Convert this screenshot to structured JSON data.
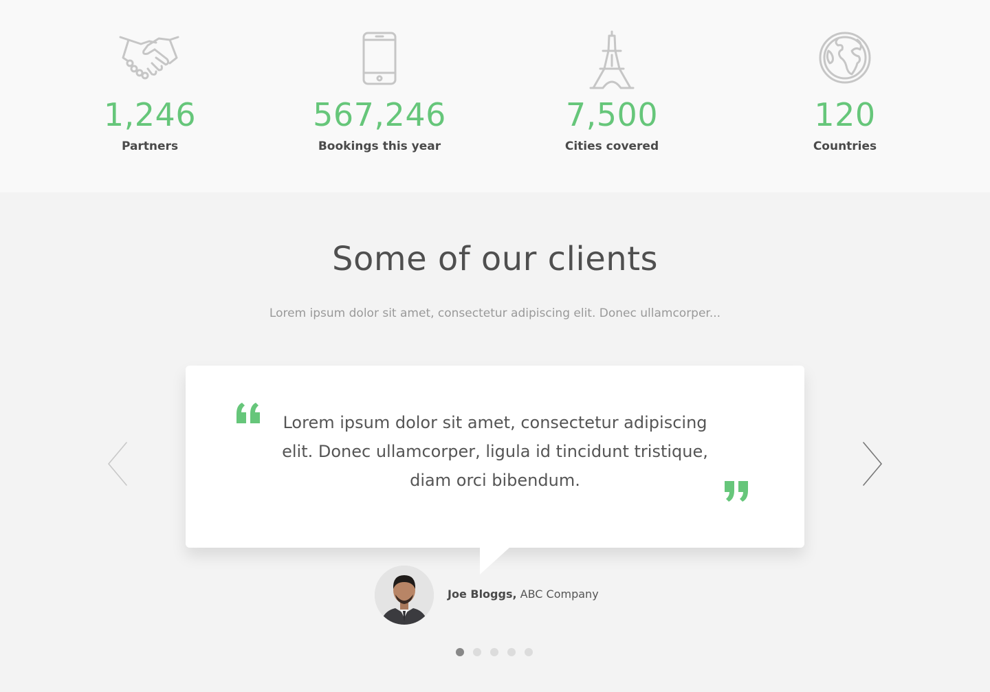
{
  "colors": {
    "accent": "#66c67a",
    "icon": "#c6c6c6",
    "card": "#ffffff"
  },
  "stats": [
    {
      "icon": "handshake-icon",
      "value": "1,246",
      "label": "Partners"
    },
    {
      "icon": "smartphone-icon",
      "value": "567,246",
      "label": "Bookings this year"
    },
    {
      "icon": "eiffel-tower-icon",
      "value": "7,500",
      "label": "Cities covered"
    },
    {
      "icon": "globe-icon",
      "value": "120",
      "label": "Countries"
    }
  ],
  "clients": {
    "heading": "Some of our clients",
    "subheading": "Lorem ipsum dolor sit amet, consectetur adipiscing elit. Donec ullamcorper...",
    "testimonial": {
      "quote": "Lorem ipsum dolor sit amet, consectetur adipiscing elit. Donec ullamcorper, ligula id tincidunt tristique, diam orci bibendum.",
      "name": "Joe Bloggs,",
      "company": "ABC Company"
    },
    "nav": {
      "prev_icon": "chevron-left-icon",
      "next_icon": "chevron-right-icon"
    },
    "pagination": {
      "total": 5,
      "active": 1
    }
  }
}
